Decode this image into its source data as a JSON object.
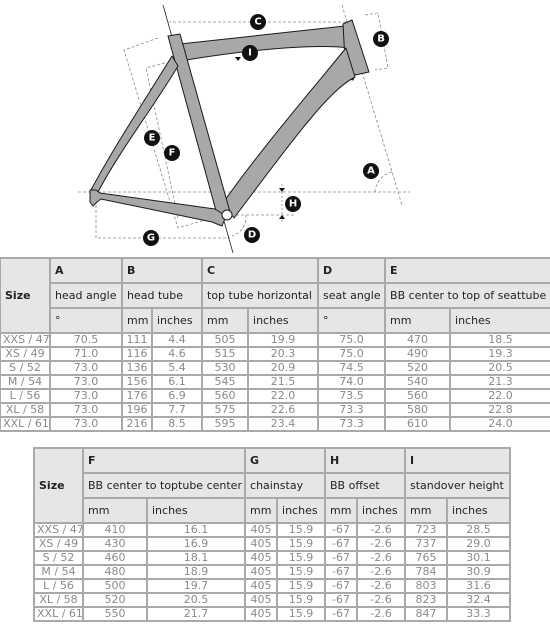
{
  "diagram": {
    "labels": [
      "A",
      "B",
      "C",
      "D",
      "E",
      "F",
      "G",
      "H",
      "I"
    ],
    "colors": {
      "frame_fill": "#a7a8aa",
      "frame_stroke": "#1a1a1a",
      "badge": "#111111",
      "dash": "#777777"
    }
  },
  "table1": {
    "size_label": "Size",
    "groups": [
      {
        "letter": "A",
        "name": "head angle",
        "units": [
          "°"
        ]
      },
      {
        "letter": "B",
        "name": "head tube",
        "units": [
          "mm",
          "inches"
        ]
      },
      {
        "letter": "C",
        "name": "top tube horizontal",
        "units": [
          "mm",
          "inches"
        ]
      },
      {
        "letter": "D",
        "name": "seat angle",
        "units": [
          "°"
        ]
      },
      {
        "letter": "E",
        "name": "BB center to top of seattube",
        "units": [
          "mm",
          "inches"
        ]
      }
    ],
    "rows": [
      [
        "XXS / 47",
        "70.5",
        "111",
        "4.4",
        "505",
        "19.9",
        "75.0",
        "470",
        "18.5"
      ],
      [
        "XS / 49",
        "71.0",
        "116",
        "4.6",
        "515",
        "20.3",
        "75.0",
        "490",
        "19.3"
      ],
      [
        "S / 52",
        "73.0",
        "136",
        "5.4",
        "530",
        "20.9",
        "74.5",
        "520",
        "20.5"
      ],
      [
        "M / 54",
        "73.0",
        "156",
        "6.1",
        "545",
        "21.5",
        "74.0",
        "540",
        "21.3"
      ],
      [
        "L / 56",
        "73.0",
        "176",
        "6.9",
        "560",
        "22.0",
        "73.5",
        "560",
        "22.0"
      ],
      [
        "XL / 58",
        "73.0",
        "196",
        "7.7",
        "575",
        "22.6",
        "73.3",
        "580",
        "22.8"
      ],
      [
        "XXL / 61",
        "73.0",
        "216",
        "8.5",
        "595",
        "23.4",
        "73.3",
        "610",
        "24.0"
      ]
    ]
  },
  "table2": {
    "size_label": "Size",
    "groups": [
      {
        "letter": "F",
        "name": "BB center to toptube center",
        "units": [
          "mm",
          "inches"
        ]
      },
      {
        "letter": "G",
        "name": "chainstay",
        "units": [
          "mm",
          "inches"
        ]
      },
      {
        "letter": "H",
        "name": "BB offset",
        "units": [
          "mm",
          "inches"
        ]
      },
      {
        "letter": "I",
        "name": "standover height",
        "units": [
          "mm",
          "inches"
        ]
      }
    ],
    "rows": [
      [
        "XXS / 47",
        "410",
        "16.1",
        "405",
        "15.9",
        "-67",
        "-2.6",
        "723",
        "28.5"
      ],
      [
        "XS / 49",
        "430",
        "16.9",
        "405",
        "15.9",
        "-67",
        "-2.6",
        "737",
        "29.0"
      ],
      [
        "S / 52",
        "460",
        "18.1",
        "405",
        "15.9",
        "-67",
        "-2.6",
        "765",
        "30.1"
      ],
      [
        "M / 54",
        "480",
        "18.9",
        "405",
        "15.9",
        "-67",
        "-2.6",
        "784",
        "30.9"
      ],
      [
        "L / 56",
        "500",
        "19.7",
        "405",
        "15.9",
        "-67",
        "-2.6",
        "803",
        "31.6"
      ],
      [
        "XL / 58",
        "520",
        "20.5",
        "405",
        "15.9",
        "-67",
        "-2.6",
        "823",
        "32.4"
      ],
      [
        "XXL / 61",
        "550",
        "21.7",
        "405",
        "15.9",
        "-67",
        "-2.6",
        "847",
        "33.3"
      ]
    ]
  }
}
